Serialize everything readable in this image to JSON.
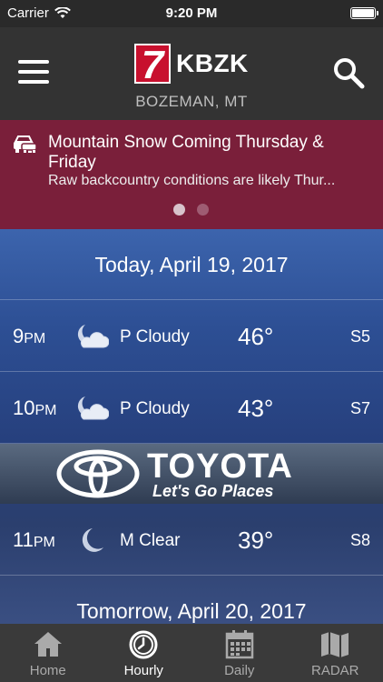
{
  "status_bar": {
    "carrier": "Carrier",
    "time": "9:20 PM",
    "battery_level": 1.0
  },
  "header": {
    "logo_number": "7",
    "logo_call": "KBZK",
    "location": "BOZEMAN, MT",
    "menu_icon": "hamburger-icon",
    "search_icon": "search-icon"
  },
  "alert": {
    "icon": "car-icon",
    "title": "Mountain Snow Coming Thursday & Friday",
    "body": "Raw backcountry conditions are likely Thur...",
    "page_count": 2,
    "active_page": 1
  },
  "forecast": {
    "today_label": "Today, April 19, 2017",
    "hours": [
      {
        "hour": "9",
        "ampm": "PM",
        "icon": "partly-cloudy-night-icon",
        "condition": "P Cloudy",
        "temp": "46°",
        "wind": "S5"
      },
      {
        "hour": "10",
        "ampm": "PM",
        "icon": "partly-cloudy-night-icon",
        "condition": "P Cloudy",
        "temp": "43°",
        "wind": "S7"
      },
      {
        "hour": "11",
        "ampm": "PM",
        "icon": "moon-icon",
        "condition": "M Clear",
        "temp": "39°",
        "wind": "S8"
      }
    ],
    "tomorrow_label": "Tomorrow, April 20, 2017"
  },
  "ad": {
    "brand": "TOYOTA",
    "tagline": "Let's Go Places"
  },
  "tabs": [
    {
      "label": "Home",
      "icon": "home-icon",
      "active": false
    },
    {
      "label": "Hourly",
      "icon": "clock-icon",
      "active": true
    },
    {
      "label": "Daily",
      "icon": "calendar-icon",
      "active": false
    },
    {
      "label": "RADAR",
      "icon": "map-icon",
      "active": false
    }
  ],
  "colors": {
    "header_bg": "#333333",
    "alert_bg": "#7a1f3a",
    "logo_red": "#c8102e",
    "tab_bar_bg": "#3a3a3a"
  }
}
